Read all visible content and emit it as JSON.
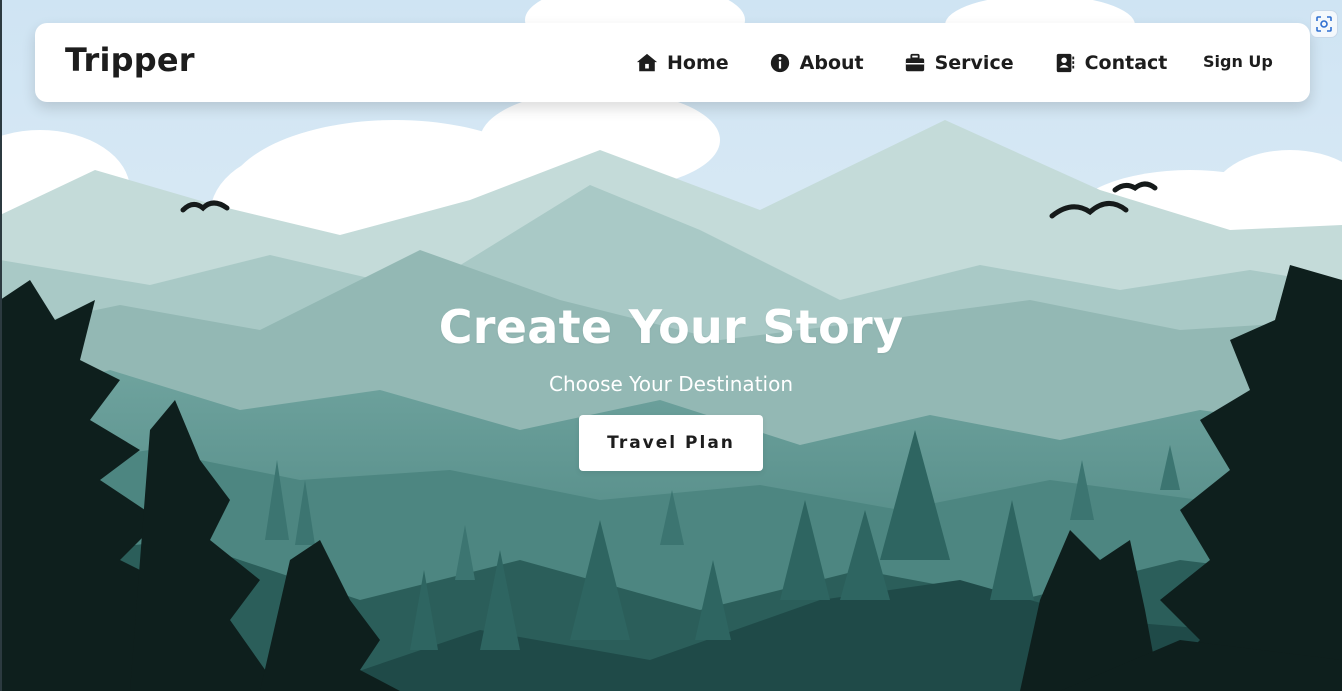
{
  "navbar": {
    "brand": "Tripper",
    "links": [
      {
        "label": "Home",
        "icon": "home-icon"
      },
      {
        "label": "About",
        "icon": "info-icon"
      },
      {
        "label": "Service",
        "icon": "briefcase-icon"
      },
      {
        "label": "Contact",
        "icon": "contact-book-icon"
      }
    ],
    "signup": "Sign Up"
  },
  "hero": {
    "title": "Create Your Story",
    "subtitle": "Choose Your Destination",
    "button": "Travel Plan"
  },
  "overlay": {
    "capture_icon": "screen-capture-icon"
  },
  "colors": {
    "sky": "#dfeef7",
    "far_mountain": "#c4dbd9",
    "mid_mountain": "#93b8b4",
    "near_mountain": "#5d938e",
    "dark_hill": "#1f4a48",
    "pine": "#0e1f1d",
    "navbar_bg": "#ffffff",
    "text_dark": "#1d1d1d"
  }
}
